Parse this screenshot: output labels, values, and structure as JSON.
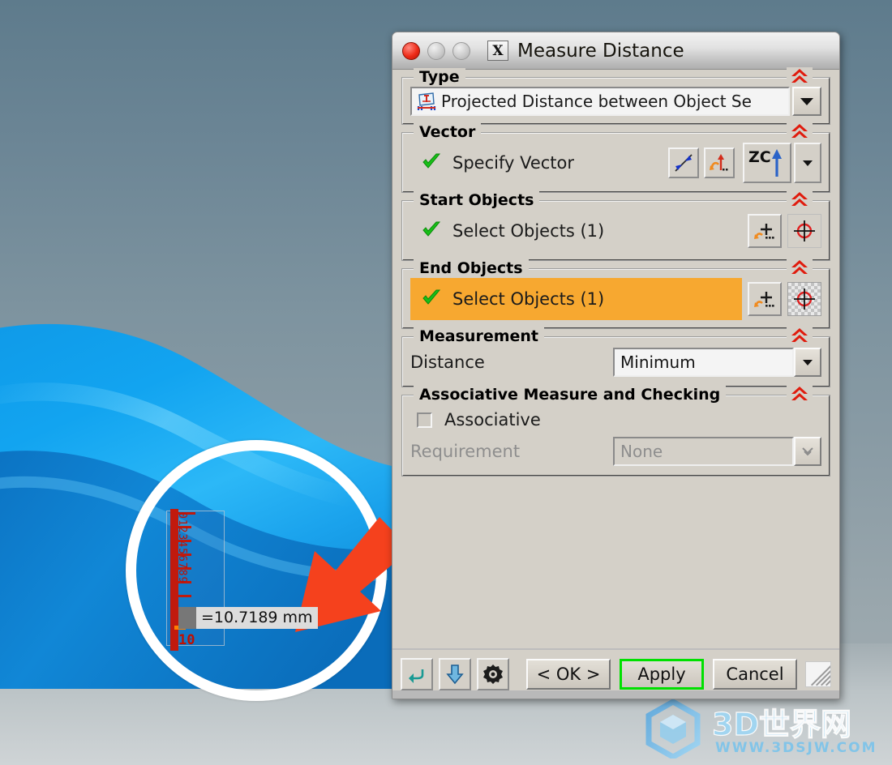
{
  "window": {
    "title": "Measure Distance",
    "app_icon": "X",
    "traffic_lights": [
      "close-red",
      "minimize-gray",
      "zoom-gray"
    ]
  },
  "sections": {
    "type": {
      "label": "Type",
      "icon": "projected-distance-icon",
      "value": "Projected Distance between Object Se",
      "collapse_icon": "double-chevron-up-icon"
    },
    "vector": {
      "label": "Vector",
      "status_icon": "green-check-icon",
      "item_label": "Specify Vector",
      "buttons": [
        {
          "name": "reverse-vector-button",
          "icon": "reverse-direction-icon"
        },
        {
          "name": "vector-dialog-button",
          "icon": "vector-constructor-icon"
        },
        {
          "name": "zc-axis-button",
          "icon": "zc-axis-icon",
          "label": "ZC"
        },
        {
          "name": "vector-dropdown-button",
          "icon": "chevron-down-icon"
        }
      ],
      "collapse_icon": "double-chevron-up-icon"
    },
    "start_objects": {
      "label": "Start Objects",
      "status_icon": "green-check-icon",
      "item_label": "Select Objects (1)",
      "buttons": [
        {
          "name": "start-select-more-button",
          "icon": "add-object-icon"
        },
        {
          "name": "start-point-button",
          "icon": "point-target-icon"
        }
      ],
      "collapse_icon": "double-chevron-up-icon"
    },
    "end_objects": {
      "label": "End Objects",
      "status_icon": "green-check-icon",
      "item_label": "Select Objects (1)",
      "highlighted": true,
      "highlight_color": "#f7a830",
      "buttons": [
        {
          "name": "end-select-more-button",
          "icon": "add-object-icon"
        },
        {
          "name": "end-point-button",
          "icon": "point-target-icon"
        }
      ],
      "collapse_icon": "double-chevron-up-icon"
    },
    "measurement": {
      "label": "Measurement",
      "distance_label": "Distance",
      "distance_value": "Minimum",
      "collapse_icon": "double-chevron-up-icon"
    },
    "associative": {
      "label": "Associative Measure and Checking",
      "checkbox_label": "Associative",
      "checkbox_checked": false,
      "requirement_label": "Requirement",
      "requirement_value": "None",
      "requirement_disabled": true,
      "collapse_icon": "double-chevron-up-icon"
    }
  },
  "footer": {
    "icon_buttons": [
      {
        "name": "undo-button",
        "icon": "undo-arrow-icon"
      },
      {
        "name": "download-button",
        "icon": "blue-down-arrow-icon"
      },
      {
        "name": "settings-button",
        "icon": "gear-icon"
      }
    ],
    "ok_label": "< OK >",
    "apply_label": "Apply",
    "cancel_label": "Cancel",
    "focus_color": "#00e000",
    "resize_grip": "resize-grip-icon"
  },
  "viewport": {
    "measurement_value": "=10.7189 mm",
    "ruler_numbers": "0123456789",
    "ruler_end_label": "10",
    "annotation_circle": "white-highlight-circle",
    "annotation_arrow": "red-pointer-arrow",
    "surface_color": "#0f9ae8"
  },
  "watermark": {
    "title": "3D世界网",
    "url": "WWW.3DSJW.COM",
    "logo": "hex-cube-logo"
  }
}
